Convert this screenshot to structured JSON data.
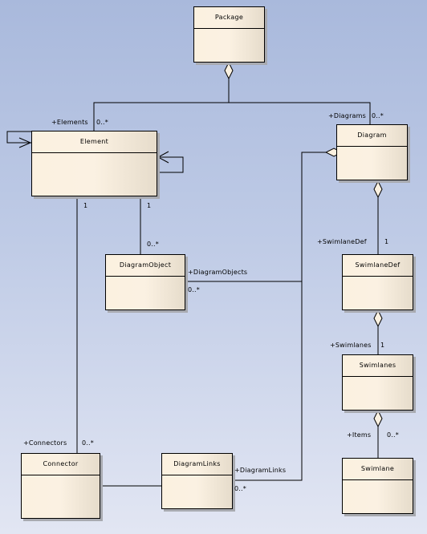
{
  "diagram": {
    "type": "UML class diagram",
    "classes": {
      "package": "Package",
      "element": "Element",
      "diagram": "Diagram",
      "diagram_object": "DiagramObject",
      "swimlane_def": "SwimlaneDef",
      "swimlanes": "Swimlanes",
      "swimlane": "Swimlane",
      "connector": "Connector",
      "diagram_links": "DiagramLinks"
    },
    "labels": {
      "elements_role": "+Elements",
      "elements_mult": "0..*",
      "diagrams_role": "+Diagrams",
      "diagrams_mult": "0..*",
      "element_conn_mult": "1",
      "element_dobj_mult": "1",
      "dobj_mult_top": "0..*",
      "diagram_objects_role": "+DiagramObjects",
      "diagram_objects_mult": "0..*",
      "swimlanedef_role": "+SwimlaneDef",
      "swimlanedef_mult": "1",
      "swimlanes_role": "+Swimlanes",
      "swimlanes_mult": "1",
      "items_role": "+Items",
      "items_mult": "0..*",
      "connectors_role": "+Connectors",
      "connectors_mult": "0..*",
      "diagram_links_role": "+DiagramLinks",
      "diagram_links_mult": "0..*"
    },
    "colors": {
      "class_fill": "#fbf1e0",
      "line": "#000000"
    }
  }
}
